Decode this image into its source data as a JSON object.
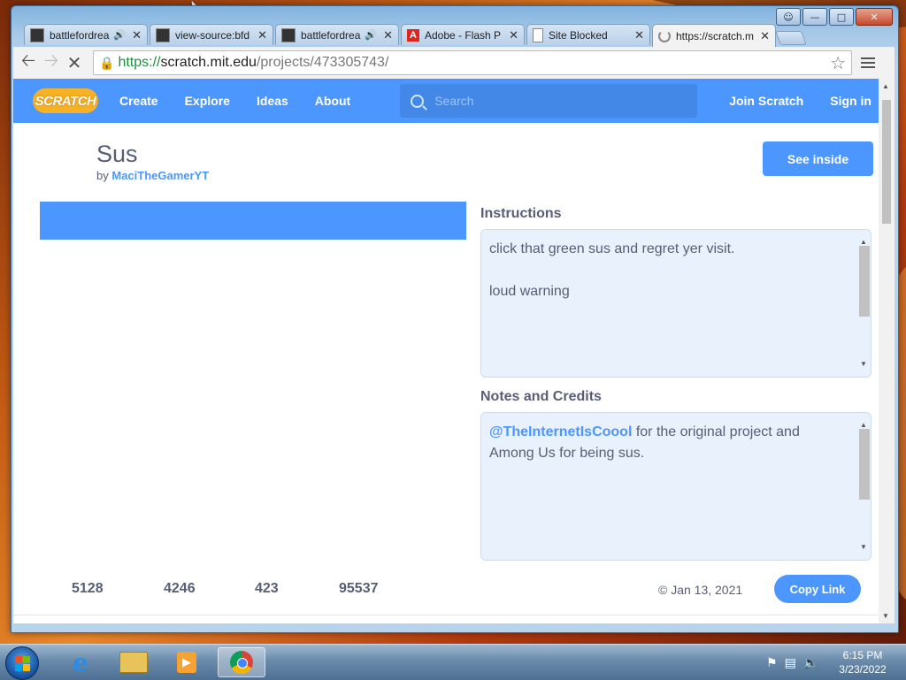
{
  "browser": {
    "tabs": [
      {
        "title": "battlefordrea",
        "audio": true,
        "icon": "dark-square-icon"
      },
      {
        "title": "view-source:bfd",
        "audio": false,
        "icon": "dark-square-icon"
      },
      {
        "title": "battlefordrea",
        "audio": true,
        "icon": "dark-square-icon"
      },
      {
        "title": "Adobe - Flash P",
        "audio": false,
        "icon": "adobe-icon"
      },
      {
        "title": "Site Blocked",
        "audio": false,
        "icon": "page-icon"
      },
      {
        "title": "https://scratch.m",
        "audio": false,
        "icon": "loading-spinner-icon",
        "active": true
      }
    ],
    "url_scheme": "https://",
    "url_host": "scratch.mit.edu",
    "url_path": "/projects/473305743/"
  },
  "scratch_nav": {
    "logo": "SCRATCH",
    "create": "Create",
    "explore": "Explore",
    "ideas": "Ideas",
    "about": "About",
    "search_placeholder": "Search",
    "join": "Join Scratch",
    "sign_in": "Sign in"
  },
  "project": {
    "title": "Sus",
    "by_label": "by",
    "author": "MaciTheGamerYT",
    "see_inside": "See inside",
    "instructions_heading": "Instructions",
    "instructions_lines": [
      "click that green sus and regret yer visit.",
      "loud warning"
    ],
    "notes_heading": "Notes and Credits",
    "notes_mention": "@TheInternetIsCoool",
    "notes_rest": " for the original project and Among Us for being sus.",
    "stats": [
      "5128",
      "4246",
      "423",
      "95537"
    ],
    "date": "© Jan 13, 2021",
    "copy_link": "Copy Link"
  },
  "taskbar": {
    "clock_time": "6:15 PM",
    "clock_date": "3/23/2022"
  },
  "colors": {
    "scratch_blue": "#4c97ff",
    "text_gray": "#575e75",
    "logo_orange": "#f7b124"
  }
}
